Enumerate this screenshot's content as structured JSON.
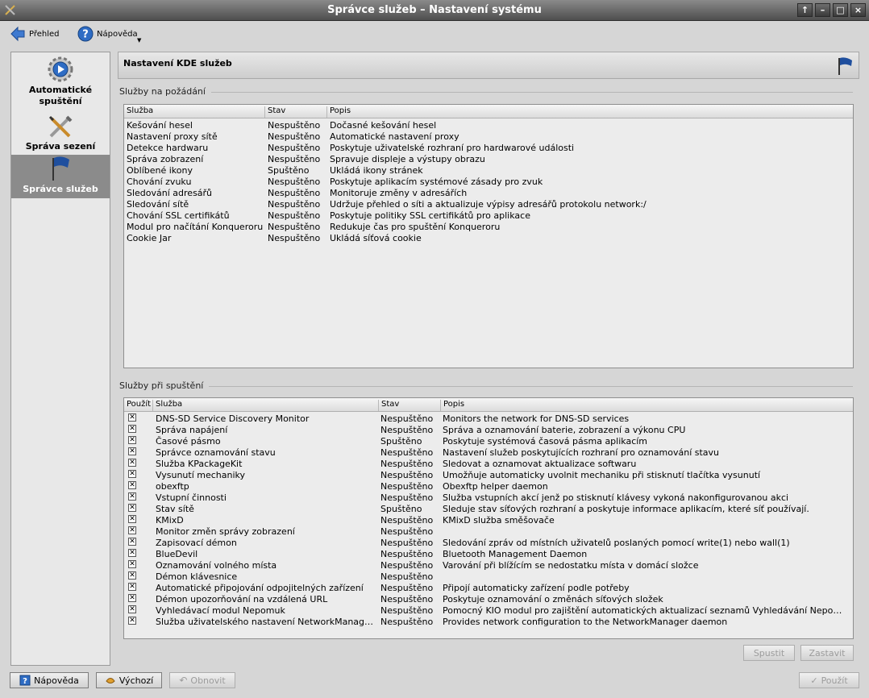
{
  "window": {
    "title": "Správce služeb – Nastavení systému",
    "buttons": [
      "↑",
      "–",
      "□",
      "×"
    ]
  },
  "toolbar": {
    "overview_label": "Přehled",
    "help_label": "Nápověda"
  },
  "sidebar": {
    "items": [
      {
        "label": "Automatické spuštění",
        "icon": "autostart-icon"
      },
      {
        "label": "Správa sezení",
        "icon": "tools-icon"
      },
      {
        "label": "Správce služeb",
        "icon": "flag-icon",
        "active": true
      }
    ]
  },
  "header": {
    "title": "Nastavení KDE služeb"
  },
  "on_demand": {
    "label": "Služby na požádání",
    "columns": [
      "Služba",
      "Stav",
      "Popis"
    ],
    "rows": [
      [
        "Kešování hesel",
        "Nespuštěno",
        "Dočasné kešování hesel"
      ],
      [
        "Nastavení proxy sítě",
        "Nespuštěno",
        "Automatické nastavení proxy"
      ],
      [
        "Detekce hardwaru",
        "Nespuštěno",
        "Poskytuje uživatelské rozhraní pro hardwarové události"
      ],
      [
        "Správa zobrazení",
        "Nespuštěno",
        "Spravuje displeje a výstupy obrazu"
      ],
      [
        "Oblíbené ikony",
        "Spuštěno",
        "Ukládá ikony stránek"
      ],
      [
        "Chování zvuku",
        "Nespuštěno",
        "Poskytuje aplikacím systémové zásady pro zvuk"
      ],
      [
        "Sledování adresářů",
        "Nespuštěno",
        "Monitoruje změny v adresářích"
      ],
      [
        "Sledování sítě",
        "Nespuštěno",
        "Udržuje přehled o síti a aktualizuje výpisy adresářů protokolu network:/"
      ],
      [
        "Chování SSL certifikátů",
        "Nespuštěno",
        "Poskytuje politiky SSL certifikátů pro aplikace"
      ],
      [
        "Modul pro načítání Konqueroru",
        "Nespuštěno",
        "Redukuje čas pro spuštění Konqueroru"
      ],
      [
        "Cookie Jar",
        "Nespuštěno",
        "Ukládá síťová cookie"
      ]
    ]
  },
  "startup": {
    "label": "Služby při spuštění",
    "columns": [
      "Použít",
      "Služba",
      "Stav",
      "Popis"
    ],
    "rows": [
      [
        "DNS-SD Service Discovery Monitor",
        "Nespuštěno",
        "Monitors the network for DNS-SD services"
      ],
      [
        "Správa napájení",
        "Nespuštěno",
        "Správa a oznamování baterie, zobrazení a výkonu CPU"
      ],
      [
        "Časové pásmo",
        "Spuštěno",
        "Poskytuje systémová časová pásma aplikacím"
      ],
      [
        "Správce oznamování stavu",
        "Nespuštěno",
        "Nastavení služeb poskytujících rozhraní pro oznamování stavu"
      ],
      [
        "Služba KPackageKit",
        "Nespuštěno",
        "Sledovat a oznamovat aktualizace softwaru"
      ],
      [
        "Vysunutí mechaniky",
        "Nespuštěno",
        "Umožňuje automaticky uvolnit mechaniku při stisknutí tlačítka vysunutí"
      ],
      [
        "obexftp",
        "Nespuštěno",
        "Obexftp helper daemon"
      ],
      [
        "Vstupní činnosti",
        "Nespuštěno",
        "Služba vstupních akcí jenž po stisknutí klávesy vykoná nakonfigurovanou akci"
      ],
      [
        "Stav sítě",
        "Spuštěno",
        "Sleduje stav síťových rozhraní a poskytuje informace aplikacím, které síť používají."
      ],
      [
        "KMixD",
        "Nespuštěno",
        "KMixD služba směšovače"
      ],
      [
        "Monitor změn správy zobrazení",
        "Nespuštěno",
        ""
      ],
      [
        "Zapisovací démon",
        "Nespuštěno",
        "Sledování zpráv od místních uživatelů poslaných pomocí write(1) nebo wall(1)"
      ],
      [
        "BlueDevil",
        "Nespuštěno",
        "Bluetooth Management Daemon"
      ],
      [
        "Oznamování volného místa",
        "Nespuštěno",
        "Varování při blížícím se nedostatku místa v domácí složce"
      ],
      [
        "Démon klávesnice",
        "Nespuštěno",
        ""
      ],
      [
        "Automatické připojování odpojitelných zařízení",
        "Nespuštěno",
        "Připojí automaticky zařízení podle potřeby"
      ],
      [
        "Démon upozorňování na vzdálená URL",
        "Nespuštěno",
        "Poskytuje oznamování o změnách síťových složek"
      ],
      [
        "Vyhledávací modul Nepomuk",
        "Nespuštěno",
        "Pomocný KIO modul pro zajištění automatických aktualizací seznamů Vyhledávání Nepomuk"
      ],
      [
        "Služba uživatelského nastavení NetworkManageru",
        "Nespuštěno",
        "Provides network configuration to the NetworkManager daemon"
      ]
    ],
    "start_button": "Spustit",
    "stop_button": "Zastavit"
  },
  "footer": {
    "help_button": "Nápověda",
    "defaults_button": "Výchozí",
    "reset_button": "Obnovit",
    "apply_button": "Použít"
  },
  "colors": {
    "titlebar": "#5a5a5a",
    "active_sidebar": "#8b8b8b",
    "flag": "#1f4f9e"
  }
}
